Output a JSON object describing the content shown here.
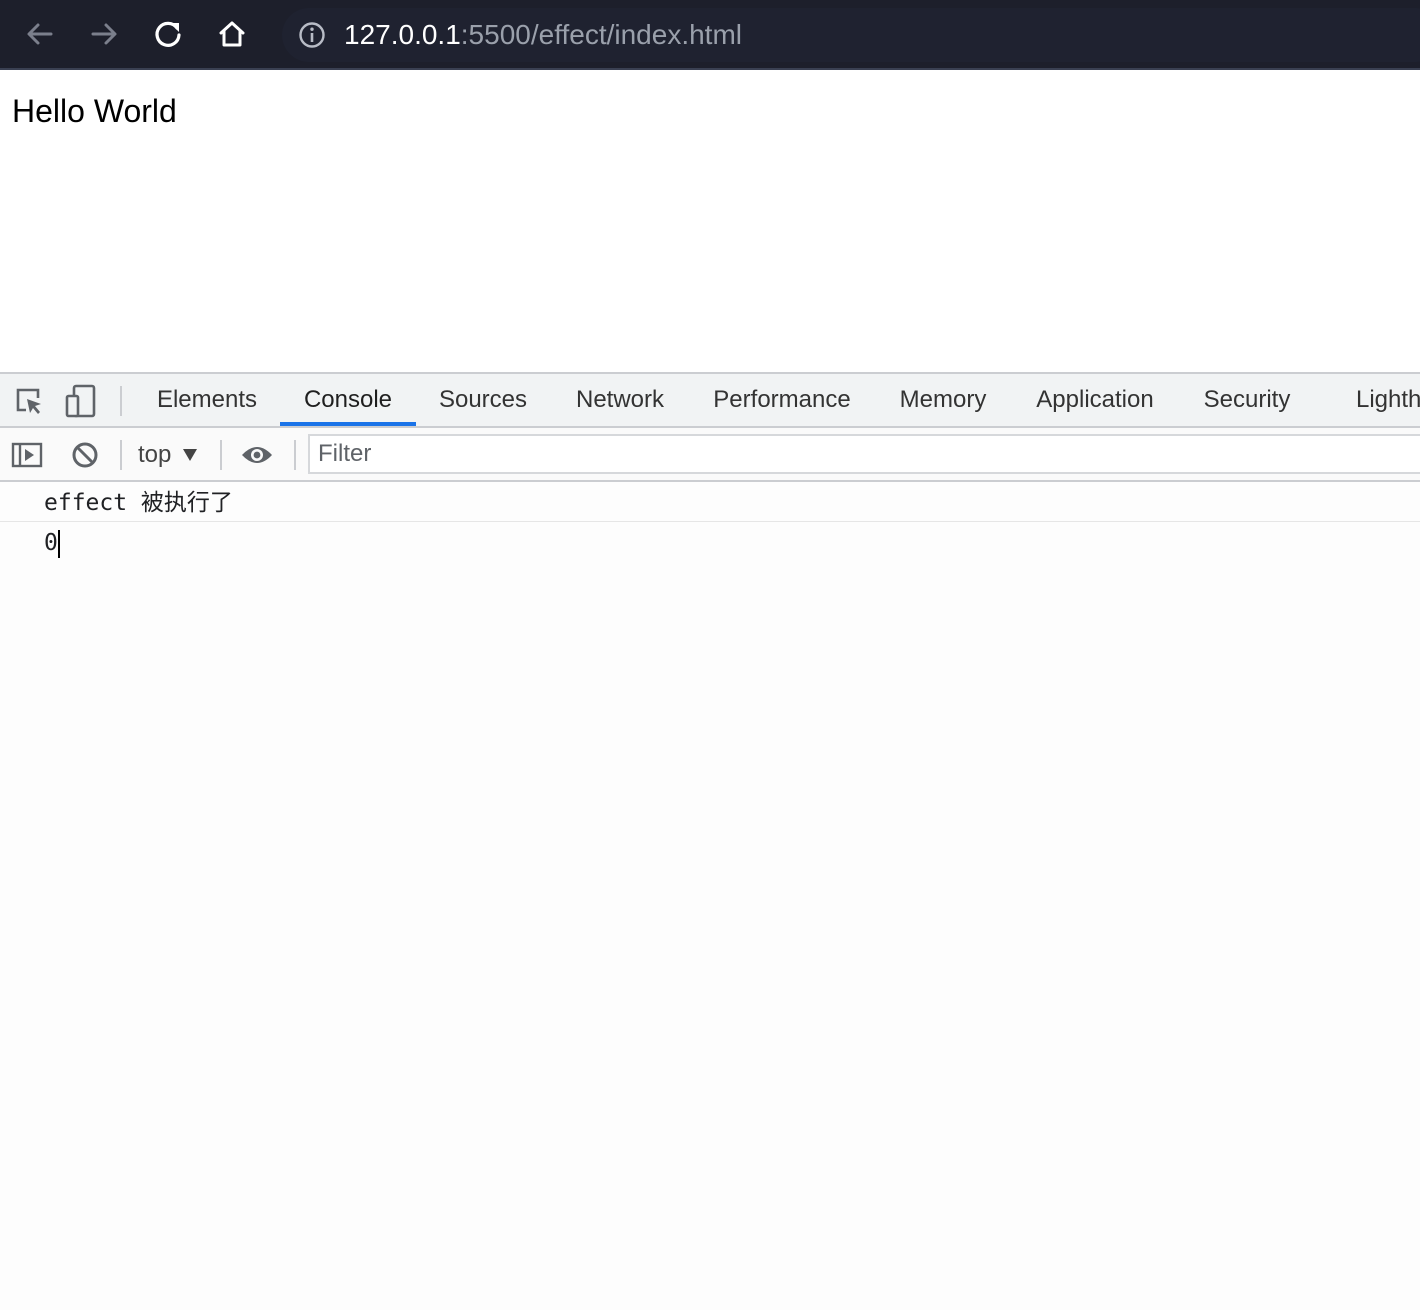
{
  "browser": {
    "url_host": "127.0.0.1",
    "url_rest": ":5500/effect/index.html"
  },
  "page": {
    "heading": "Hello World"
  },
  "devtools": {
    "tabs": [
      {
        "label": "Elements"
      },
      {
        "label": "Console"
      },
      {
        "label": "Sources"
      },
      {
        "label": "Network"
      },
      {
        "label": "Performance"
      },
      {
        "label": "Memory"
      },
      {
        "label": "Application"
      },
      {
        "label": "Security"
      },
      {
        "label": "Lighth"
      }
    ],
    "active_tab": "Console",
    "context": "top",
    "filter_placeholder": "Filter",
    "messages": [
      {
        "text": "effect 被执行了"
      }
    ],
    "prompt_value": "0"
  },
  "colors": {
    "accent": "#1a73e8",
    "toolbar_bg": "#1d1f2b"
  }
}
